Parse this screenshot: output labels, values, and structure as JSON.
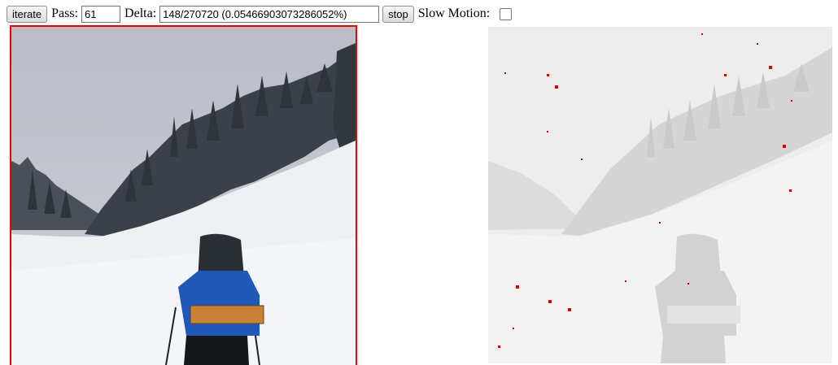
{
  "toolbar": {
    "iterate_label": "iterate",
    "pass_label": "Pass:",
    "pass_value": "61",
    "delta_label": "Delta:",
    "delta_value": "148/270720 (0.05466903073286052%)",
    "stop_label": "stop",
    "slow_motion_label": "Slow Motion:",
    "slow_motion_checked": false
  },
  "canvases": {
    "left": {
      "content": "snowy-mountain-hiker-image",
      "border_color": "#ee0000"
    },
    "right": {
      "content": "faded-diff-image",
      "diff_marker_color": "#dd0000"
    }
  }
}
